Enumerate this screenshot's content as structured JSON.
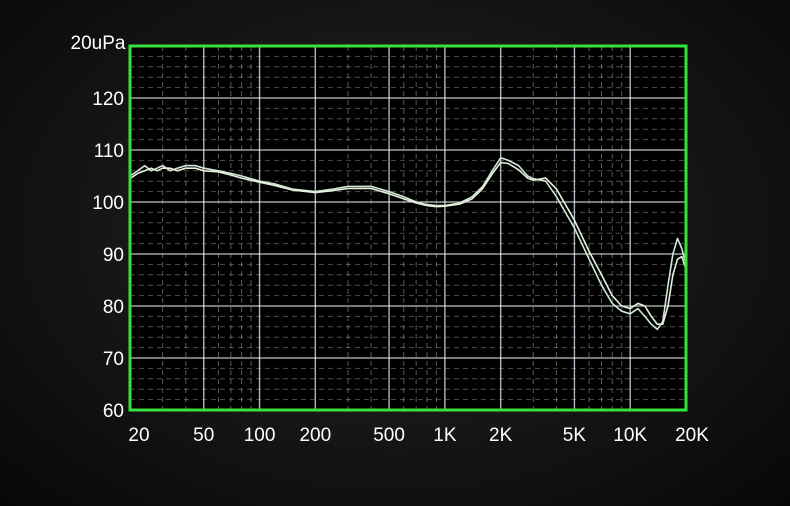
{
  "chart_data": {
    "type": "line",
    "title": "",
    "xlabel": "",
    "ylabel": "20uPa",
    "x_scale": "log",
    "xlim": [
      20,
      20000
    ],
    "ylim": [
      60,
      130
    ],
    "grid": true,
    "x_tick_labels": [
      {
        "value": 20,
        "label": "20"
      },
      {
        "value": 50,
        "label": "50"
      },
      {
        "value": 100,
        "label": "100"
      },
      {
        "value": 200,
        "label": "200"
      },
      {
        "value": 500,
        "label": "500"
      },
      {
        "value": 1000,
        "label": "1K"
      },
      {
        "value": 2000,
        "label": "2K"
      },
      {
        "value": 5000,
        "label": "5K"
      },
      {
        "value": 10000,
        "label": "10K"
      },
      {
        "value": 20000,
        "label": "20K"
      }
    ],
    "y_tick_labels": [
      {
        "value": 60,
        "label": "60"
      },
      {
        "value": 70,
        "label": "70"
      },
      {
        "value": 80,
        "label": "80"
      },
      {
        "value": 90,
        "label": "90"
      },
      {
        "value": 100,
        "label": "100"
      },
      {
        "value": 110,
        "label": "110"
      },
      {
        "value": 120,
        "label": "120"
      }
    ],
    "series": [
      {
        "color": "#cfe8d8",
        "points": [
          [
            20,
            105
          ],
          [
            22,
            106
          ],
          [
            24,
            107
          ],
          [
            26,
            106
          ],
          [
            28,
            106.5
          ],
          [
            30,
            107
          ],
          [
            33,
            106
          ],
          [
            36,
            106.5
          ],
          [
            40,
            107
          ],
          [
            45,
            107
          ],
          [
            50,
            106.5
          ],
          [
            60,
            106
          ],
          [
            70,
            105.5
          ],
          [
            80,
            105
          ],
          [
            100,
            104
          ],
          [
            120,
            103.5
          ],
          [
            150,
            102.5
          ],
          [
            200,
            102
          ],
          [
            250,
            102.5
          ],
          [
            300,
            103
          ],
          [
            400,
            103
          ],
          [
            500,
            102
          ],
          [
            600,
            101
          ],
          [
            700,
            100
          ],
          [
            800,
            99.5
          ],
          [
            900,
            99.3
          ],
          [
            1000,
            99.3
          ],
          [
            1200,
            99.8
          ],
          [
            1400,
            101
          ],
          [
            1600,
            103
          ],
          [
            1800,
            106
          ],
          [
            2000,
            108.5
          ],
          [
            2200,
            108
          ],
          [
            2500,
            107
          ],
          [
            2800,
            105
          ],
          [
            3000,
            104.5
          ],
          [
            3500,
            104
          ],
          [
            4000,
            101
          ],
          [
            5000,
            95
          ],
          [
            6000,
            89
          ],
          [
            7000,
            84
          ],
          [
            8000,
            80.5
          ],
          [
            9000,
            79
          ],
          [
            10000,
            78.5
          ],
          [
            11000,
            79.5
          ],
          [
            12000,
            78
          ],
          [
            13000,
            76.5
          ],
          [
            14000,
            75.5
          ],
          [
            15000,
            77
          ],
          [
            16000,
            84
          ],
          [
            17000,
            90
          ],
          [
            18000,
            93
          ],
          [
            19000,
            91
          ],
          [
            20000,
            88
          ]
        ]
      },
      {
        "color": "#e8f0dc",
        "points": [
          [
            20,
            104.5
          ],
          [
            22,
            105.5
          ],
          [
            24,
            106
          ],
          [
            26,
            106.5
          ],
          [
            28,
            106
          ],
          [
            30,
            106.5
          ],
          [
            33,
            106.5
          ],
          [
            36,
            106
          ],
          [
            40,
            106.5
          ],
          [
            45,
            106.5
          ],
          [
            50,
            106
          ],
          [
            60,
            105.8
          ],
          [
            70,
            105.2
          ],
          [
            80,
            104.6
          ],
          [
            100,
            103.8
          ],
          [
            120,
            103.2
          ],
          [
            150,
            102.3
          ],
          [
            200,
            101.8
          ],
          [
            250,
            102.2
          ],
          [
            300,
            102.6
          ],
          [
            400,
            102.6
          ],
          [
            500,
            101.6
          ],
          [
            600,
            100.6
          ],
          [
            700,
            99.8
          ],
          [
            800,
            99.3
          ],
          [
            900,
            99.1
          ],
          [
            1000,
            99.2
          ],
          [
            1200,
            99.6
          ],
          [
            1400,
            100.6
          ],
          [
            1600,
            102.6
          ],
          [
            1800,
            105.4
          ],
          [
            2000,
            107.6
          ],
          [
            2200,
            107.4
          ],
          [
            2500,
            106.2
          ],
          [
            2800,
            104.6
          ],
          [
            3000,
            104.2
          ],
          [
            3500,
            104.6
          ],
          [
            4000,
            102.5
          ],
          [
            5000,
            96.5
          ],
          [
            6000,
            90.5
          ],
          [
            7000,
            86
          ],
          [
            8000,
            82
          ],
          [
            9000,
            80
          ],
          [
            10000,
            79.5
          ],
          [
            11000,
            80.5
          ],
          [
            12000,
            80
          ],
          [
            13000,
            78
          ],
          [
            14000,
            76.5
          ],
          [
            15000,
            76.5
          ],
          [
            16000,
            80
          ],
          [
            17000,
            86
          ],
          [
            18000,
            89
          ],
          [
            19000,
            89.5
          ],
          [
            20000,
            87
          ]
        ]
      }
    ]
  }
}
